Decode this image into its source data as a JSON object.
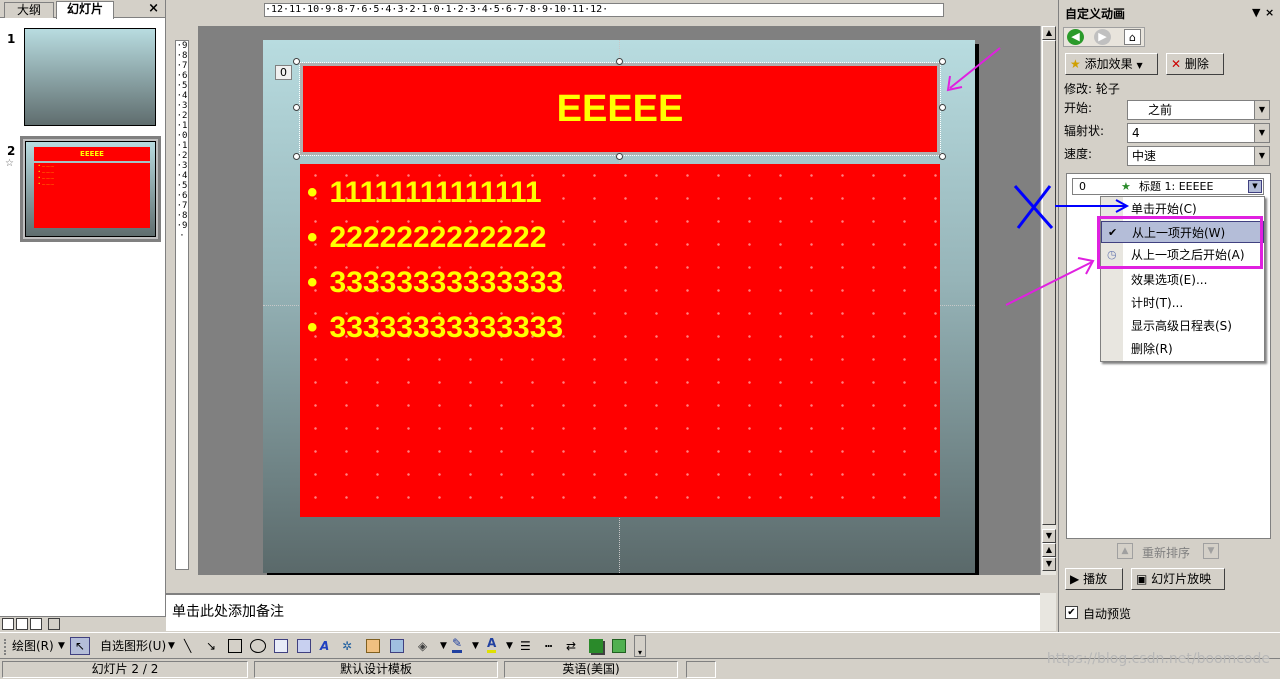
{
  "left_pane": {
    "tab_outline": "大纲",
    "tab_slides": "幻灯片",
    "close": "×",
    "slide1_num": "1",
    "slide2_num": "2",
    "slide2_thumb_title": "EEEEE"
  },
  "ruler": {
    "horizontal": "·12·11·10·9·8·7·6·5·4·3·2·1·0·1·2·3·4·5·6·7·8·9·10·11·12·",
    "vertical": "·9·8·7·6·5·4·3·2·1·0·1·2·3·4·5·6·7·8·9·"
  },
  "slide": {
    "title": "EEEEE",
    "bullets": [
      "11111111111111",
      "2222222222222",
      "33333333333333",
      "33333333333333"
    ],
    "anim_tag": "0"
  },
  "notes": {
    "placeholder": "单击此处添加备注"
  },
  "task_pane": {
    "title": "自定义动画",
    "add_effect": "添加效果",
    "remove": "删除",
    "modify_label": "修改: 轮子",
    "start_label": "开始:",
    "start_value": "之前",
    "spokes_label": "辐射状:",
    "spokes_value": "4",
    "speed_label": "速度:",
    "speed_value": "中速",
    "effect_index": "0",
    "effect_name": "标题 1: EEEEE",
    "reorder": "重新排序",
    "play": "播放",
    "slideshow": "幻灯片放映",
    "autopreview": "自动预览"
  },
  "context_menu": {
    "items": [
      "单击开始(C)",
      "从上一项开始(W)",
      "从上一项之后开始(A)",
      "效果选项(E)...",
      "计时(T)...",
      "显示高级日程表(S)",
      "删除(R)"
    ]
  },
  "draw_toolbar": {
    "draw": "绘图(R)",
    "autoshapes": "自选图形(U)"
  },
  "status_bar": {
    "slide_count": "幻灯片 2 / 2",
    "template": "默认设计模板",
    "language": "英语(美国)"
  },
  "watermark": "https://blog.csdn.net/boomcode",
  "colors": {
    "slide_red": "#ff0000",
    "slide_text_yellow": "#ffff00",
    "annotation_pink": "#e020e0",
    "annotation_blue": "#0000ff"
  }
}
